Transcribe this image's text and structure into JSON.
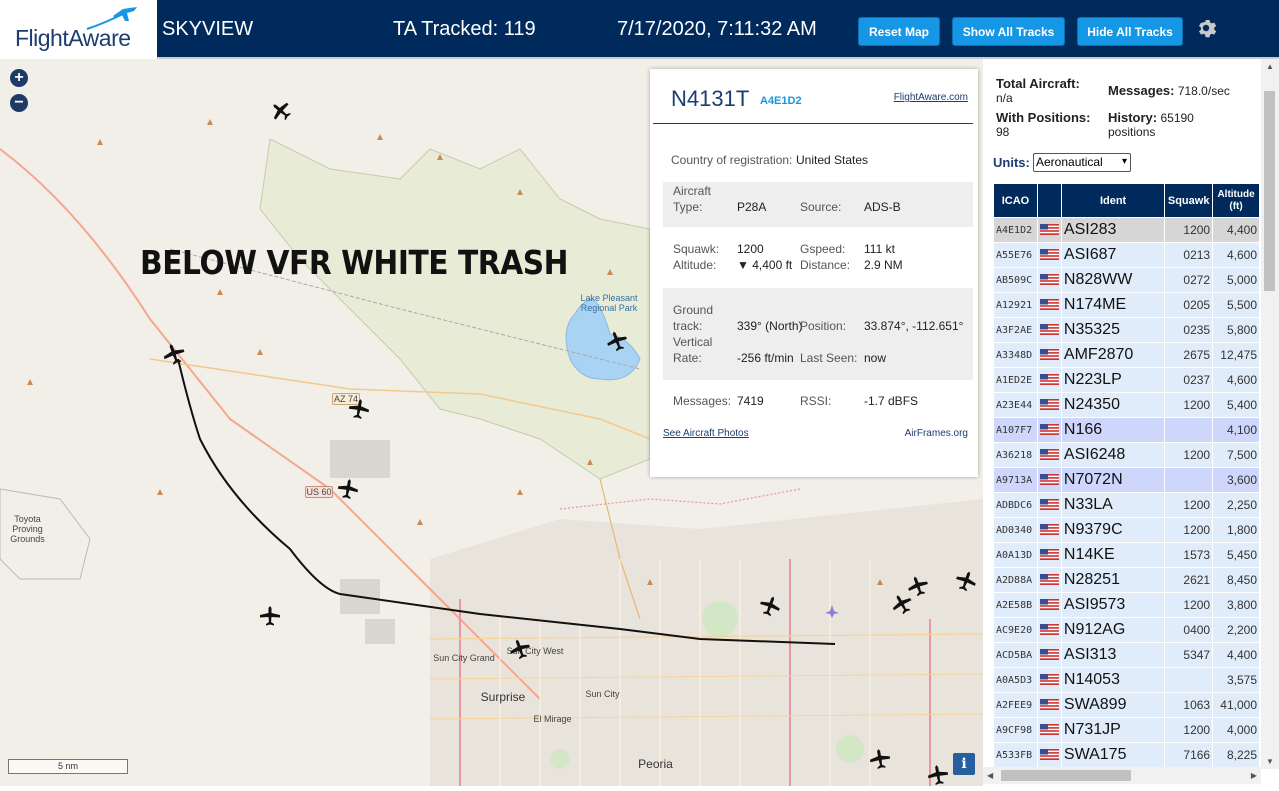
{
  "header": {
    "logo": "FlightAware",
    "app_name": "SKYVIEW",
    "ta_tracked": "TA Tracked: 119",
    "clock": "7/17/2020, 7:11:32 AM",
    "buttons": {
      "reset": "Reset Map",
      "show_all": "Show All Tracks",
      "hide_all": "Hide All Tracks"
    },
    "settings_icon": "gear-icon"
  },
  "map": {
    "overlay_text": "BELOW VFR WHITE TRASH",
    "zoom_in": "+",
    "zoom_out": "−",
    "scale": "5 nm",
    "info": "i",
    "places": {
      "lake": "Lake Pleasant Regional Park",
      "toyota": "Toyota Proving Grounds",
      "sun_city_grand": "Sun City Grand",
      "sun_city_west": "Sun City West",
      "surprise": "Surprise",
      "sun_city": "Sun City",
      "el_mirage": "El Mirage",
      "peoria": "Peoria",
      "az74": "AZ 74",
      "us60": "US 60"
    }
  },
  "detail": {
    "ident": "N4131T",
    "icao": "A4E1D2",
    "fa_link": "FlightAware.com",
    "country_label": "Country of registration:",
    "country": "United States",
    "aircraft_type_label": "Aircraft Type:",
    "aircraft_type_l1": "Aircraft",
    "aircraft_type_l2": "Type:",
    "aircraft_type": "P28A",
    "source_label": "Source:",
    "source": "ADS-B",
    "squawk_label": "Squawk:",
    "squawk": "1200",
    "gspeed_label": "Gspeed:",
    "gspeed": "111 kt",
    "altitude_label": "Altitude:",
    "altitude": "▼ 4,400 ft",
    "distance_label": "Distance:",
    "distance": "2.9 NM",
    "ground_l1": "Ground",
    "ground_l2": "track:",
    "track": "339° (North)",
    "position_label": "Position:",
    "position": "33.874°, -112.651°",
    "vert_l1": "Vertical",
    "vert_l2": "Rate:",
    "vert_rate": "-256 ft/min",
    "last_seen_label": "Last Seen:",
    "last_seen": "now",
    "messages_label": "Messages:",
    "messages": "7419",
    "rssi_label": "RSSI:",
    "rssi": "-1.7 dBFS",
    "photos_link": "See Aircraft Photos",
    "airframes_link": "AirFrames.org"
  },
  "sidebar": {
    "total_label": "Total Aircraft:",
    "total": "n/a",
    "messages_label": "Messages:",
    "messages": "718.0/sec",
    "with_pos_label": "With Positions:",
    "with_pos": "98",
    "history_label": "History:",
    "history": "65190 positions",
    "history_l1": "65190",
    "history_l2": "positions",
    "units_label": "Units:",
    "units": "Aeronautical",
    "columns": [
      "ICAO",
      "",
      "Ident",
      "Squawk",
      "Altitude (ft)"
    ],
    "rows": [
      {
        "icao": "A4E1D2",
        "ident": "ASI283",
        "squawk": "1200",
        "alt": "4,400",
        "style": "sel"
      },
      {
        "icao": "A55E76",
        "ident": "ASI687",
        "squawk": "0213",
        "alt": "4,600",
        "style": "r"
      },
      {
        "icao": "AB509C",
        "ident": "N828WW",
        "squawk": "0272",
        "alt": "5,000",
        "style": "r"
      },
      {
        "icao": "A12921",
        "ident": "N174ME",
        "squawk": "0205",
        "alt": "5,500",
        "style": "r"
      },
      {
        "icao": "A3F2AE",
        "ident": "N35325",
        "squawk": "0235",
        "alt": "5,800",
        "style": "r"
      },
      {
        "icao": "A3348D",
        "ident": "AMF2870",
        "squawk": "2675",
        "alt": "12,475",
        "style": "r"
      },
      {
        "icao": "A1ED2E",
        "ident": "N223LP",
        "squawk": "0237",
        "alt": "4,600",
        "style": "r"
      },
      {
        "icao": "A23E44",
        "ident": "N24350",
        "squawk": "1200",
        "alt": "5,400",
        "style": "r"
      },
      {
        "icao": "A107F7",
        "ident": "N166",
        "squawk": "",
        "alt": "4,100",
        "style": "lav"
      },
      {
        "icao": "A36218",
        "ident": "ASI6248",
        "squawk": "1200",
        "alt": "7,500",
        "style": "r"
      },
      {
        "icao": "A9713A",
        "ident": "N7072N",
        "squawk": "",
        "alt": "3,600",
        "style": "lav"
      },
      {
        "icao": "ADBDC6",
        "ident": "N33LA",
        "squawk": "1200",
        "alt": "2,250",
        "style": "r"
      },
      {
        "icao": "AD0340",
        "ident": "N9379C",
        "squawk": "1200",
        "alt": "1,800",
        "style": "r"
      },
      {
        "icao": "A0A13D",
        "ident": "N14KE",
        "squawk": "1573",
        "alt": "5,450",
        "style": "r"
      },
      {
        "icao": "A2D88A",
        "ident": "N28251",
        "squawk": "2621",
        "alt": "8,450",
        "style": "r"
      },
      {
        "icao": "A2E58B",
        "ident": "ASI9573",
        "squawk": "1200",
        "alt": "3,800",
        "style": "r"
      },
      {
        "icao": "AC9E20",
        "ident": "N912AG",
        "squawk": "0400",
        "alt": "2,200",
        "style": "r"
      },
      {
        "icao": "ACD5BA",
        "ident": "ASI313",
        "squawk": "5347",
        "alt": "4,400",
        "style": "r"
      },
      {
        "icao": "A0A5D3",
        "ident": "N14053",
        "squawk": "",
        "alt": "3,575",
        "style": "r"
      },
      {
        "icao": "A2FEE9",
        "ident": "SWA899",
        "squawk": "1063",
        "alt": "41,000",
        "style": "r"
      },
      {
        "icao": "A9CF98",
        "ident": "N731JP",
        "squawk": "1200",
        "alt": "4,000",
        "style": "r"
      },
      {
        "icao": "A533FB",
        "ident": "SWA175",
        "squawk": "7166",
        "alt": "8,225",
        "style": "r"
      }
    ]
  }
}
